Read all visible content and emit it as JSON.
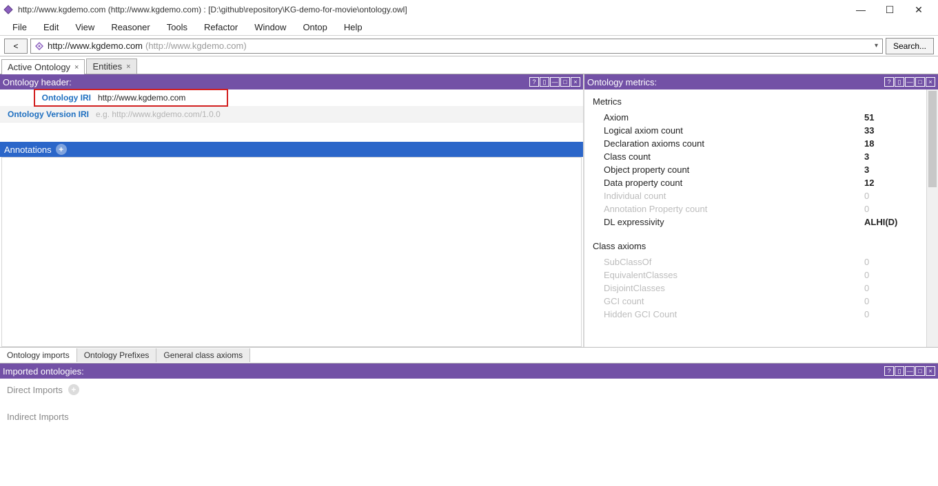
{
  "window": {
    "title": "http://www.kgdemo.com (http://www.kgdemo.com) : [D:\\github\\repository\\KG-demo-for-movie\\ontology.owl]"
  },
  "menu": {
    "items": [
      "File",
      "Edit",
      "View",
      "Reasoner",
      "Tools",
      "Refactor",
      "Window",
      "Ontop",
      "Help"
    ]
  },
  "nav": {
    "back": "<",
    "iri_main": "http://www.kgdemo.com",
    "iri_paren": "(http://www.kgdemo.com)",
    "search": "Search..."
  },
  "tabs": {
    "items": [
      {
        "label": "Active Ontology"
      },
      {
        "label": "Entities"
      }
    ]
  },
  "header_panel": {
    "title": "Ontology header:",
    "rows": {
      "iri_label": "Ontology IRI",
      "iri_value": "http://www.kgdemo.com",
      "ver_label": "Ontology Version IRI",
      "ver_placeholder": "e.g. http://www.kgdemo.com/1.0.0"
    },
    "annotations_label": "Annotations"
  },
  "metrics_panel": {
    "title": "Ontology metrics:",
    "section1": "Metrics",
    "rows1": [
      {
        "k": "Axiom",
        "v": "51"
      },
      {
        "k": "Logical axiom count",
        "v": "33"
      },
      {
        "k": "Declaration axioms count",
        "v": "18"
      },
      {
        "k": "Class count",
        "v": "3"
      },
      {
        "k": "Object property count",
        "v": "3"
      },
      {
        "k": "Data property count",
        "v": "12"
      },
      {
        "k": "Individual count",
        "v": "0",
        "dis": true
      },
      {
        "k": "Annotation Property count",
        "v": "0",
        "dis": true
      },
      {
        "k": "DL expressivity",
        "v": "ALHI(D)"
      }
    ],
    "section2": "Class axioms",
    "rows2": [
      {
        "k": "SubClassOf",
        "v": "0",
        "dis": true
      },
      {
        "k": "EquivalentClasses",
        "v": "0",
        "dis": true
      },
      {
        "k": "DisjointClasses",
        "v": "0",
        "dis": true
      },
      {
        "k": "GCI count",
        "v": "0",
        "dis": true
      },
      {
        "k": "Hidden GCI Count",
        "v": "0",
        "dis": true
      }
    ]
  },
  "bottom_tabs": {
    "items": [
      "Ontology imports",
      "Ontology Prefixes",
      "General class axioms"
    ]
  },
  "imported": {
    "title": "Imported ontologies:",
    "direct": "Direct Imports",
    "indirect": "Indirect Imports"
  }
}
